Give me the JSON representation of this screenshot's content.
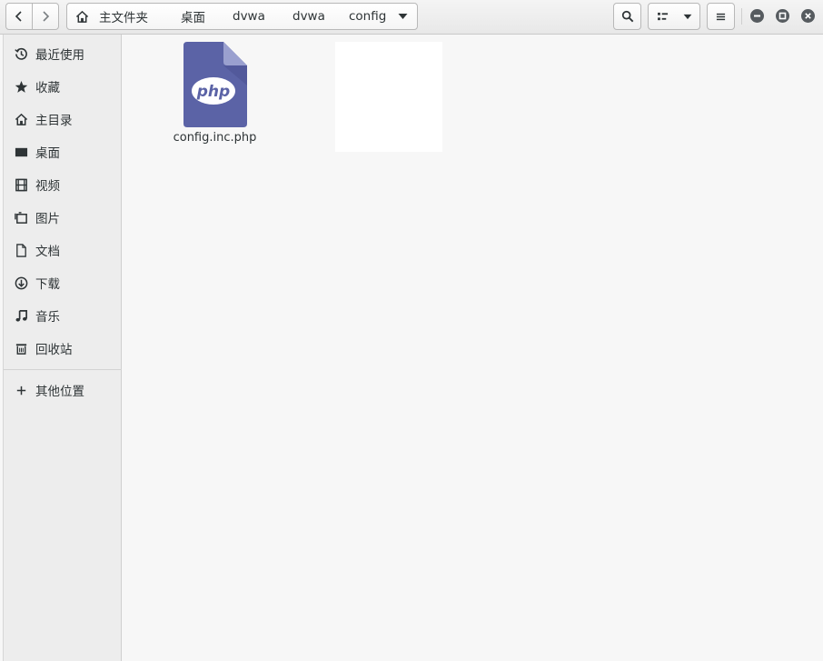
{
  "pathbar": {
    "crumbs": [
      "主文件夹",
      "桌面",
      "dvwa",
      "dvwa",
      "config"
    ]
  },
  "sidebar": {
    "items": [
      {
        "label": "最近使用",
        "icon": "recent-icon"
      },
      {
        "label": "收藏",
        "icon": "star-icon"
      },
      {
        "label": "主目录",
        "icon": "home-icon"
      },
      {
        "label": "桌面",
        "icon": "desktop-icon"
      },
      {
        "label": "视频",
        "icon": "video-icon"
      },
      {
        "label": "图片",
        "icon": "picture-icon"
      },
      {
        "label": "文档",
        "icon": "document-icon"
      },
      {
        "label": "下载",
        "icon": "download-icon"
      },
      {
        "label": "音乐",
        "icon": "music-icon"
      },
      {
        "label": "回收站",
        "icon": "trash-icon"
      }
    ],
    "other": {
      "label": "其他位置",
      "icon": "plus-icon"
    }
  },
  "files": [
    {
      "name": "config.inc.php",
      "icon": "php-file-icon",
      "badge": "php"
    }
  ],
  "colors": {
    "php_icon": "#5b63a6",
    "php_fold": "#9aa0cf",
    "window_ctl": "#565b5f",
    "sidebar_bg": "#ededed",
    "content_bg": "#f7f7f7"
  }
}
